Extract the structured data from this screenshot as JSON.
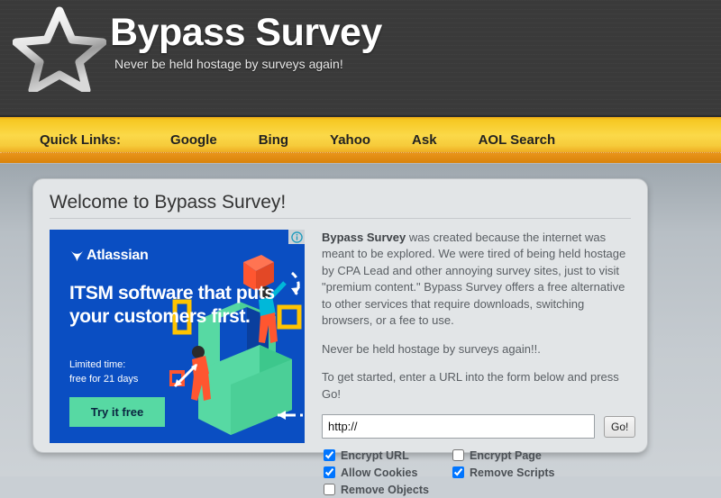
{
  "header": {
    "logo_icon": "star-icon",
    "title": "Bypass Survey",
    "tagline": "Never be held hostage by surveys again!"
  },
  "nav": {
    "label": "Quick Links:",
    "links": [
      {
        "label": "Google"
      },
      {
        "label": "Bing"
      },
      {
        "label": "Yahoo"
      },
      {
        "label": "Ask"
      },
      {
        "label": "AOL Search"
      }
    ]
  },
  "panel": {
    "title": "Welcome to Bypass Survey!",
    "paragraphs": [
      {
        "lead": "Bypass Survey",
        "rest": " was created because the internet was meant to be explored. We were tired of being held hostage by CPA Lead and other annoying survey sites, just to visit \"premium content.\" Bypass Survey offers a free alternative to other services that require downloads, switching browsers, or a fee to use."
      },
      {
        "text": "Never be held hostage by surveys again!!."
      },
      {
        "text": "To get started, enter a URL into the form below and press Go!"
      }
    ]
  },
  "form": {
    "url_value": "http://",
    "url_placeholder": "http://",
    "go_label": "Go!",
    "checkboxes": [
      {
        "id": "encrypt-url",
        "label": "Encrypt URL",
        "checked": true
      },
      {
        "id": "encrypt-page",
        "label": "Encrypt Page",
        "checked": false
      },
      {
        "id": "allow-cookies",
        "label": "Allow Cookies",
        "checked": true
      },
      {
        "id": "remove-scripts",
        "label": "Remove Scripts",
        "checked": true
      },
      {
        "id": "remove-objects",
        "label": "Remove Objects",
        "checked": false
      }
    ]
  },
  "ad": {
    "brand": "Atlassian",
    "brand_icon": "atlassian-logo-icon",
    "headline": "ITSM software that puts your customers first.",
    "subtext": "Limited time:\nfree for 21 days",
    "cta_label": "Try it free",
    "info_icon": "adchoices-info-icon",
    "colors": {
      "background": "#0a4ec2",
      "cta_background": "#57d9a3",
      "accent_green": "#57d9a3",
      "accent_orange": "#ff5630",
      "accent_yellow": "#ffc400"
    }
  },
  "theme": {
    "header_background": "#3a3a3a",
    "nav_gold": "#f6c722",
    "nav_orange": "#d9830c",
    "page_background": "#c5cbd0",
    "panel_background": "#e2e5e7"
  }
}
